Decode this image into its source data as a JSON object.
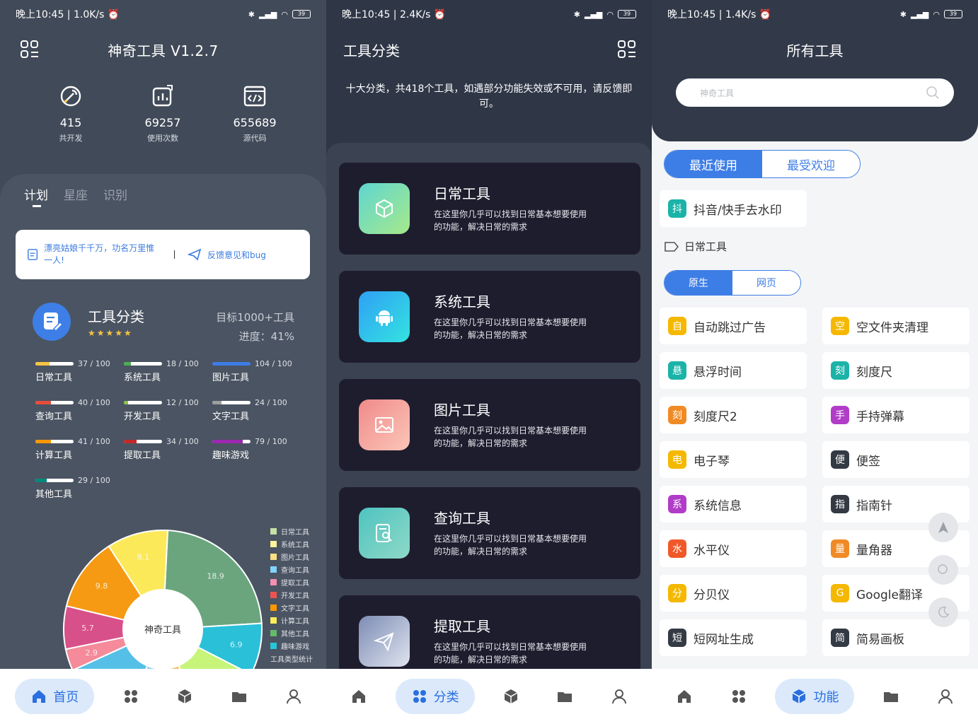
{
  "status_bars": [
    {
      "time": "晚上10:45",
      "speed": "1.0K/s",
      "battery": "39"
    },
    {
      "time": "晚上10:45",
      "speed": "2.4K/s",
      "battery": "39"
    },
    {
      "time": "晚上10:45",
      "speed": "1.4K/s",
      "battery": "39"
    }
  ],
  "home": {
    "title": "神奇工具 V1.2.7",
    "stats": [
      {
        "value": "415",
        "label": "共开发",
        "icon": "wrench-icon"
      },
      {
        "value": "69257",
        "label": "使用次数",
        "icon": "chart-icon"
      },
      {
        "value": "655689",
        "label": "源代码",
        "icon": "code-icon"
      }
    ],
    "tabs": [
      "计划",
      "星座",
      "识别"
    ],
    "notice_text": "漂亮姑娘千千万，功名万里惟一人!",
    "feedback_label": "反馈意见和bug",
    "category": {
      "title": "工具分类",
      "stars": "★★★★★",
      "goal": "目标1000+工具",
      "progress": "进度：41%",
      "bars": [
        {
          "name": "日常工具",
          "value": "37 / 100",
          "ratio": 0.37,
          "color": "#f5c443"
        },
        {
          "name": "系统工具",
          "value": "18 / 100",
          "ratio": 0.18,
          "color": "#4caf50"
        },
        {
          "name": "图片工具",
          "value": "104 / 100",
          "ratio": 1.0,
          "color": "#3d7de6"
        },
        {
          "name": "查询工具",
          "value": "40 / 100",
          "ratio": 0.4,
          "color": "#e74c3c"
        },
        {
          "name": "开发工具",
          "value": "12 / 100",
          "ratio": 0.12,
          "color": "#8bc34a"
        },
        {
          "name": "文字工具",
          "value": "24 / 100",
          "ratio": 0.24,
          "color": "#9e9e9e"
        },
        {
          "name": "计算工具",
          "value": "41 / 100",
          "ratio": 0.41,
          "color": "#ff9800"
        },
        {
          "name": "提取工具",
          "value": "34 / 100",
          "ratio": 0.34,
          "color": "#c62828"
        },
        {
          "name": "趣味游戏",
          "value": "79 / 100",
          "ratio": 0.79,
          "color": "#9c27b0"
        },
        {
          "name": "其他工具",
          "value": "29 / 100",
          "ratio": 0.29,
          "color": "#00897b"
        }
      ]
    },
    "pie_center": "神奇工具",
    "legend": [
      {
        "name": "日常工具",
        "color": "#c5e1a5"
      },
      {
        "name": "系统工具",
        "color": "#fff59d"
      },
      {
        "name": "图片工具",
        "color": "#ffe082"
      },
      {
        "name": "查询工具",
        "color": "#81d4fa"
      },
      {
        "name": "提取工具",
        "color": "#f48fb1"
      },
      {
        "name": "开发工具",
        "color": "#ef5350"
      },
      {
        "name": "文字工具",
        "color": "#ff9800"
      },
      {
        "name": "计算工具",
        "color": "#ffee58"
      },
      {
        "name": "其他工具",
        "color": "#66bb6a"
      },
      {
        "name": "趣味游戏",
        "color": "#26c6da"
      }
    ],
    "legend_caption": "工具类型统计"
  },
  "chart_data": {
    "type": "pie",
    "title": "",
    "slices": [
      {
        "label": "18.9",
        "value": 18.9,
        "color": "#6aa57e"
      },
      {
        "label": "6.9",
        "value": 6.9,
        "color": "#29c0d8"
      },
      {
        "label": "8.9",
        "value": 8.9,
        "color": "#c6f57a"
      },
      {
        "label": "",
        "value": 4.5,
        "color": "#f0c070"
      },
      {
        "label": "",
        "value": 6.0,
        "color": "#9ad0f0"
      },
      {
        "label": "9.6",
        "value": 9.6,
        "color": "#55bfe8"
      },
      {
        "label": "2.9",
        "value": 2.9,
        "color": "#f48a9a"
      },
      {
        "label": "5.7",
        "value": 5.7,
        "color": "#d8508a"
      },
      {
        "label": "9.8",
        "value": 9.8,
        "color": "#f59a12"
      },
      {
        "label": "8.1",
        "value": 8.1,
        "color": "#fce95a"
      }
    ]
  },
  "category_page": {
    "title": "工具分类",
    "desc": "十大分类，共418个工具，如遇部分功能失效或不可用，请反馈即可。",
    "cards": [
      {
        "title": "日常工具",
        "desc": "在这里你几乎可以找到日常基本想要使用的功能，解决日常的需求",
        "icon": "cube-icon",
        "bg": "linear-gradient(135deg,#5fd6d0,#a6e98a)"
      },
      {
        "title": "系统工具",
        "desc": "在这里你几乎可以找到日常基本想要使用的功能，解决日常的需求",
        "icon": "android-icon",
        "bg": "linear-gradient(135deg,#2fa0f5,#34e3e0)"
      },
      {
        "title": "图片工具",
        "desc": "在这里你几乎可以找到日常基本想要使用的功能，解决日常的需求",
        "icon": "image-icon",
        "bg": "linear-gradient(135deg,#f08a8a,#fbc6b8)"
      },
      {
        "title": "查询工具",
        "desc": "在这里你几乎可以找到日常基本想要使用的功能，解决日常的需求",
        "icon": "search-doc-icon",
        "bg": "linear-gradient(135deg,#4fc3c0,#8ed9c7)"
      },
      {
        "title": "提取工具",
        "desc": "在这里你几乎可以找到日常基本想要使用的功能，解决日常的需求",
        "icon": "send-icon",
        "bg": "linear-gradient(135deg,#7d8cb4,#dfe4ef)"
      }
    ]
  },
  "all_tools": {
    "title": "所有工具",
    "search_placeholder": "神奇工具",
    "seg1": [
      "最近使用",
      "最受欢迎"
    ],
    "recent": {
      "badge": "抖",
      "name": "抖音/快手去水印",
      "color": "#1bb3a8"
    },
    "section": "日常工具",
    "seg2": [
      "原生",
      "网页"
    ],
    "tools": [
      {
        "badge": "自",
        "name": "自动跳过广告",
        "color": "#f5b800"
      },
      {
        "badge": "空",
        "name": "空文件夹清理",
        "color": "#f5b800"
      },
      {
        "badge": "悬",
        "name": "悬浮时间",
        "color": "#1bb3a8"
      },
      {
        "badge": "刻",
        "name": "刻度尺",
        "color": "#1bb3a8"
      },
      {
        "badge": "刻",
        "name": "刻度尺2",
        "color": "#f08a24"
      },
      {
        "badge": "手",
        "name": "手持弹幕",
        "color": "#b03cc8"
      },
      {
        "badge": "电",
        "name": "电子琴",
        "color": "#f5b800"
      },
      {
        "badge": "便",
        "name": "便签",
        "color": "#333a44"
      },
      {
        "badge": "系",
        "name": "系统信息",
        "color": "#b03cc8"
      },
      {
        "badge": "指",
        "name": "指南针",
        "color": "#333a44"
      },
      {
        "badge": "水",
        "name": "水平仪",
        "color": "#f0582a"
      },
      {
        "badge": "量",
        "name": "量角器",
        "color": "#f08a24"
      },
      {
        "badge": "分",
        "name": "分贝仪",
        "color": "#f5b800"
      },
      {
        "badge": "G",
        "name": "Google翻译",
        "color": "#f5b800"
      },
      {
        "badge": "短",
        "name": "短网址生成",
        "color": "#333a44"
      },
      {
        "badge": "简",
        "name": "简易画板",
        "color": "#333a44"
      }
    ]
  },
  "nav": {
    "home": "首页",
    "category": "分类",
    "function": "功能"
  }
}
